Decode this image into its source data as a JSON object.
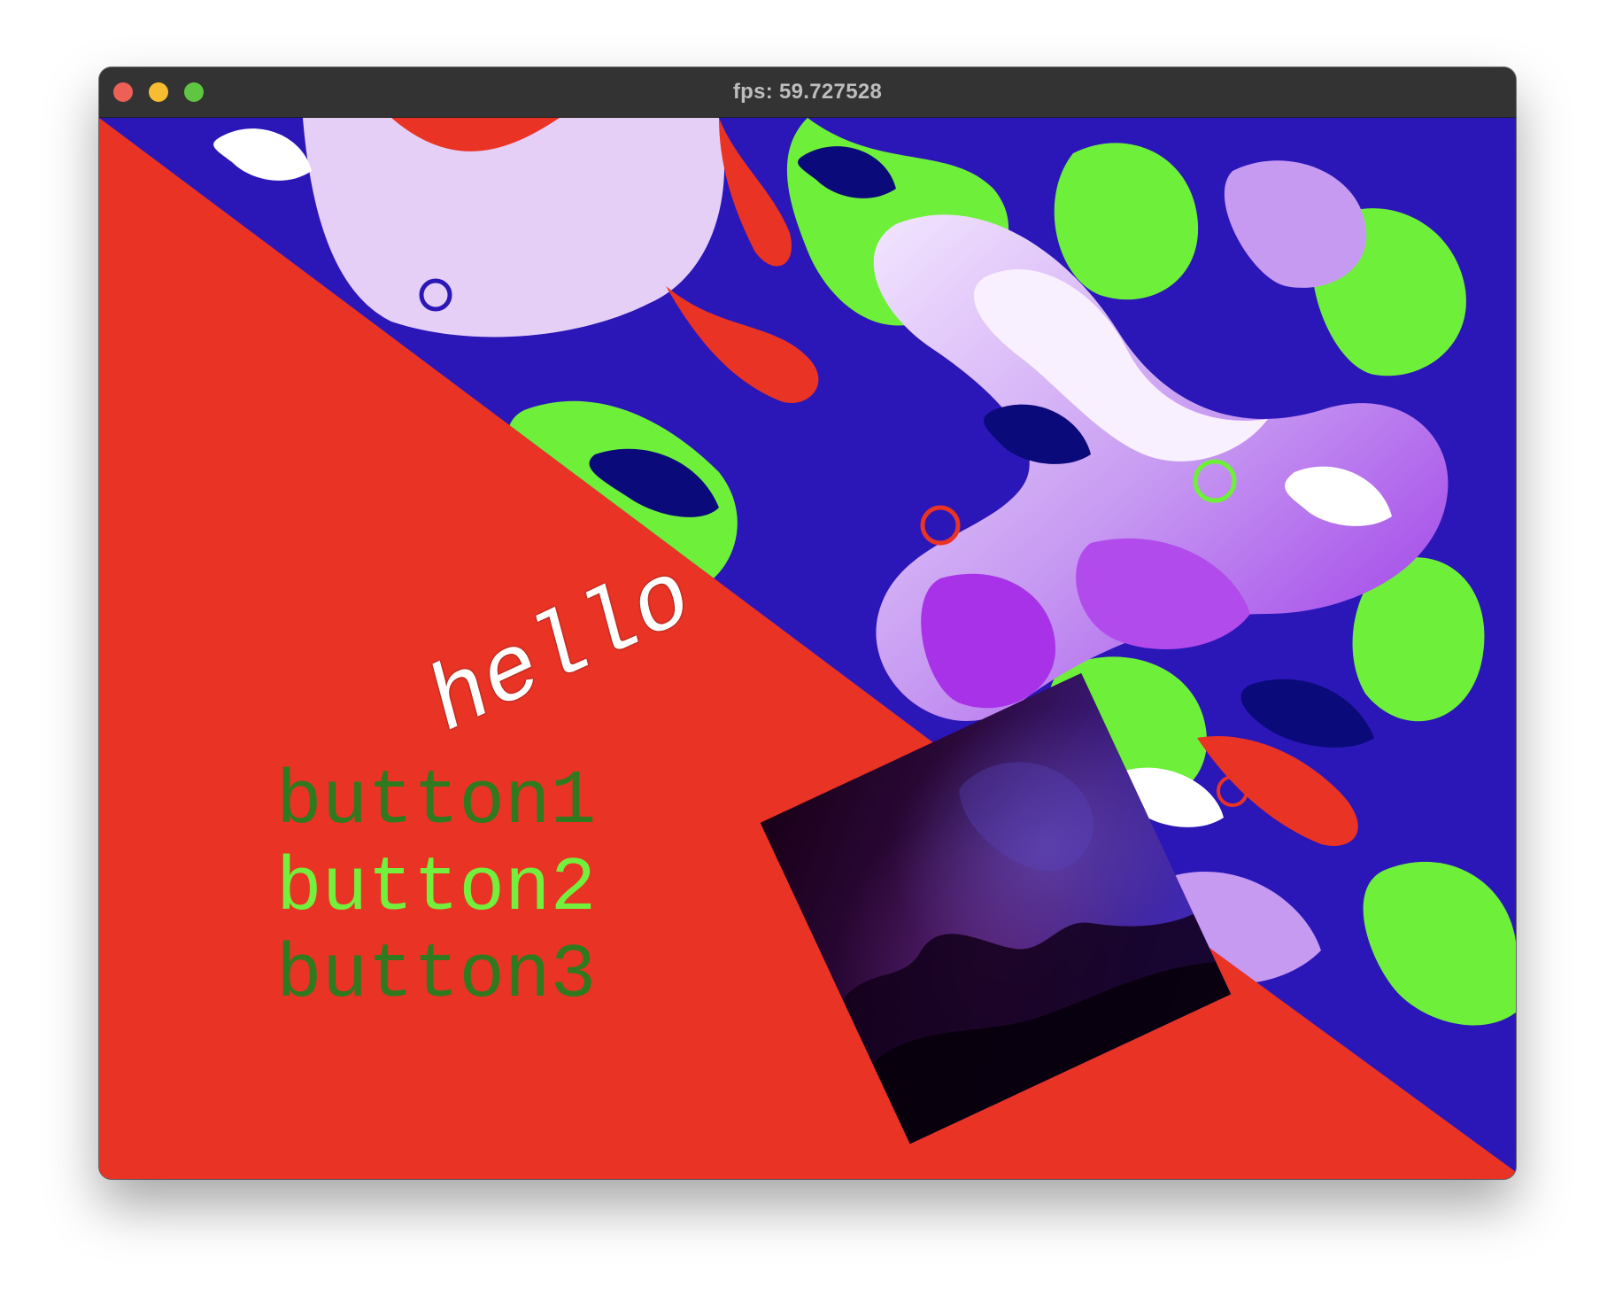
{
  "window": {
    "title": "fps: 59.727528"
  },
  "traffic_lights": {
    "close_color": "#ee5f56",
    "minimize_color": "#f5bd2f",
    "maximize_color": "#5ec640"
  },
  "scene": {
    "background_color": "#e83325",
    "hello_text": "hello",
    "buttons": [
      {
        "label": "button1",
        "color": "#2f7a1e"
      },
      {
        "label": "button2",
        "color": "#73f03c"
      },
      {
        "label": "button3",
        "color": "#2f7a1e"
      }
    ]
  }
}
